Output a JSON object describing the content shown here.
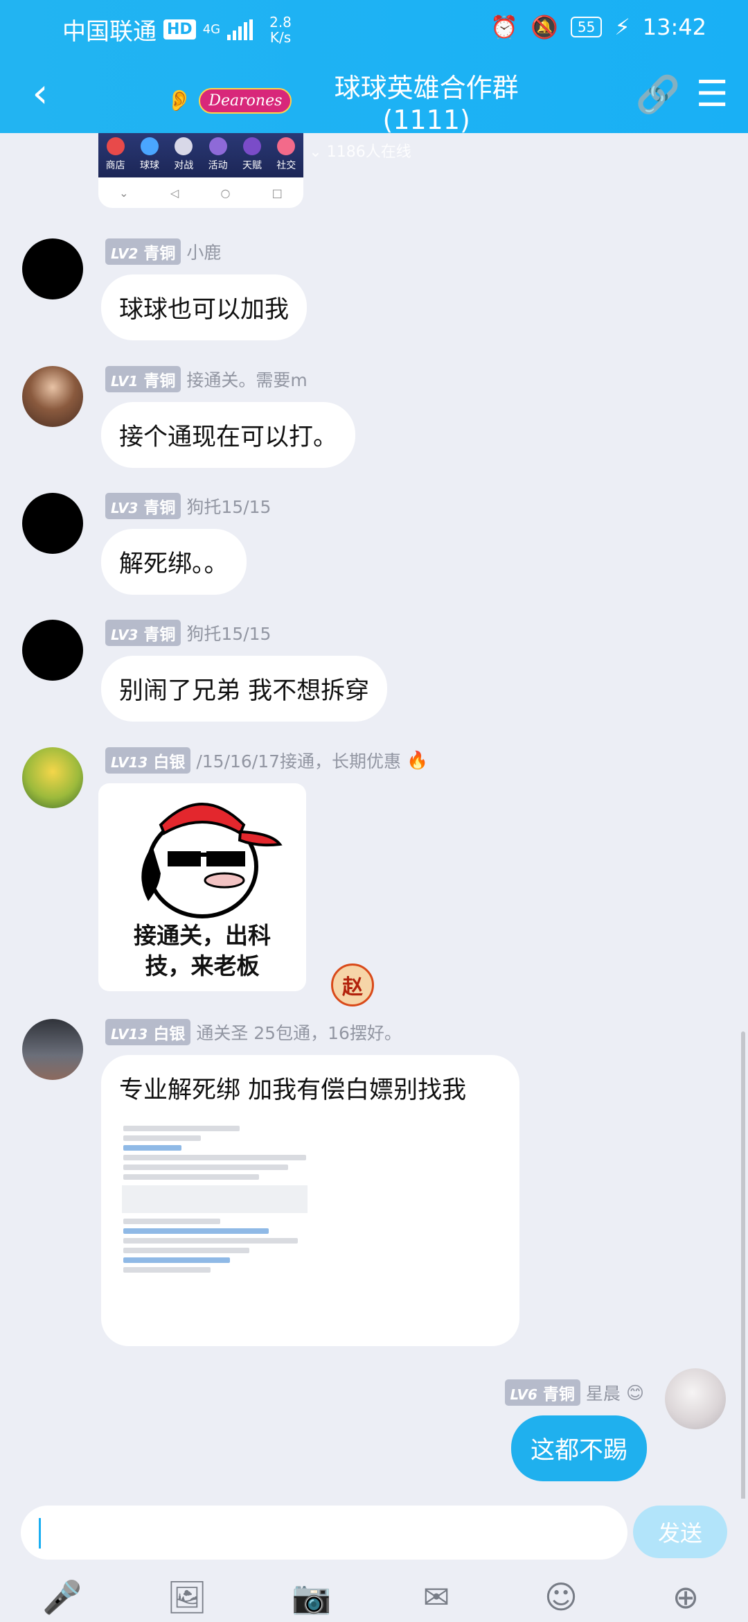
{
  "status_bar": {
    "carrier": "中国联通",
    "hd": "HD",
    "network": "4G",
    "speed": "2.8",
    "speed_unit": "K/s",
    "battery": "55",
    "time": "13:42"
  },
  "header": {
    "brand_logo": "Dearones",
    "title": "球球英雄合作群(1111)",
    "online": "1186人在线"
  },
  "preview_tabs": [
    "商店",
    "球球",
    "对战",
    "活动",
    "天赋",
    "社交"
  ],
  "messages": [
    {
      "level": "LV2",
      "rank": "青铜",
      "name": "小鹿",
      "text": "球球也可以加我"
    },
    {
      "level": "LV1",
      "rank": "青铜",
      "name": "接通关。需要m",
      "text": "接个通现在可以打。"
    },
    {
      "level": "LV3",
      "rank": "青铜",
      "name": "狗托15/15",
      "text": "解死绑。。"
    },
    {
      "level": "LV3",
      "rank": "青铜",
      "name": "狗托15/15",
      "text": "别闹了兄弟  我不想拆穿"
    },
    {
      "level": "LV13",
      "rank": "白银",
      "name": "/15/16/17接通，长期优惠",
      "sticker_text": "接通关，出科\n技，来老板",
      "badge": "赵"
    },
    {
      "level": "LV13",
      "rank": "白银",
      "name": "通关圣 25包通，16摆好。",
      "text": "专业解死绑 加我有偿白嫖别找我"
    }
  ],
  "self_message": {
    "level": "LV6",
    "rank": "青铜",
    "name": "星晨",
    "text": "这都不踢"
  },
  "composer": {
    "placeholder": "",
    "send_label": "发送"
  },
  "icons": {
    "back": "chevron-left-icon",
    "link": "link-icon",
    "menu": "menu-icon",
    "tools": [
      "microphone-icon",
      "image-icon",
      "camera-icon",
      "red-packet-icon",
      "emoji-icon",
      "plus-icon"
    ]
  }
}
